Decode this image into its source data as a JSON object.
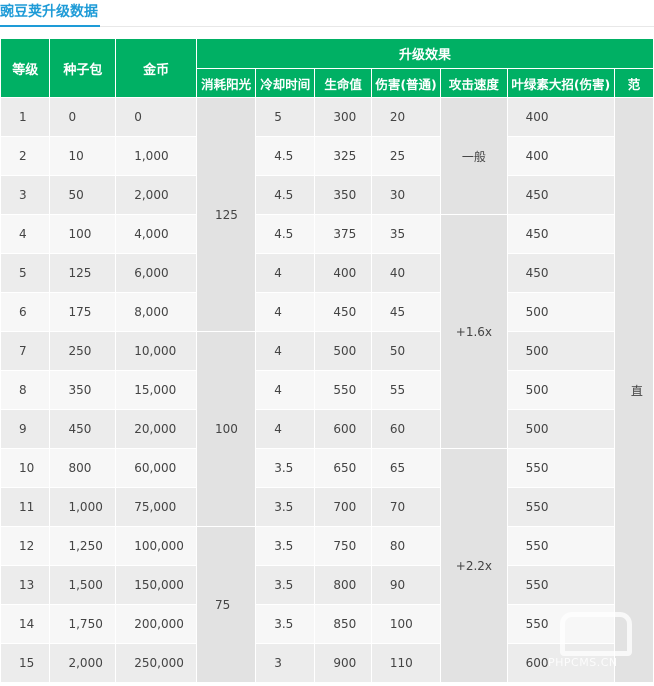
{
  "title": "豌豆荚升级数据",
  "headers": {
    "level": "等级",
    "seeds": "种子包",
    "coins": "金币",
    "effect_group": "升级效果",
    "sun_cost": "消耗阳光",
    "cooldown": "冷却时间",
    "health": "生命值",
    "damage": "伤害(普通)",
    "attack_speed": "攻击速度",
    "chlorophyll": "叶绿素大招(伤害)",
    "range_partial": "范"
  },
  "rows": [
    {
      "level": "1",
      "seeds": "0",
      "coins": "0",
      "cooldown": "5",
      "health": "300",
      "damage": "20",
      "chlorophyll": "400"
    },
    {
      "level": "2",
      "seeds": "10",
      "coins": "1,000",
      "cooldown": "4.5",
      "health": "325",
      "damage": "25",
      "chlorophyll": "400"
    },
    {
      "level": "3",
      "seeds": "50",
      "coins": "2,000",
      "cooldown": "4.5",
      "health": "350",
      "damage": "30",
      "chlorophyll": "450"
    },
    {
      "level": "4",
      "seeds": "100",
      "coins": "4,000",
      "cooldown": "4.5",
      "health": "375",
      "damage": "35",
      "chlorophyll": "450"
    },
    {
      "level": "5",
      "seeds": "125",
      "coins": "6,000",
      "cooldown": "4",
      "health": "400",
      "damage": "40",
      "chlorophyll": "450"
    },
    {
      "level": "6",
      "seeds": "175",
      "coins": "8,000",
      "cooldown": "4",
      "health": "450",
      "damage": "45",
      "chlorophyll": "500"
    },
    {
      "level": "7",
      "seeds": "250",
      "coins": "10,000",
      "cooldown": "4",
      "health": "500",
      "damage": "50",
      "chlorophyll": "500"
    },
    {
      "level": "8",
      "seeds": "350",
      "coins": "15,000",
      "cooldown": "4",
      "health": "550",
      "damage": "55",
      "chlorophyll": "500"
    },
    {
      "level": "9",
      "seeds": "450",
      "coins": "20,000",
      "cooldown": "4",
      "health": "600",
      "damage": "60",
      "chlorophyll": "500"
    },
    {
      "level": "10",
      "seeds": "800",
      "coins": "60,000",
      "cooldown": "3.5",
      "health": "650",
      "damage": "65",
      "chlorophyll": "550"
    },
    {
      "level": "11",
      "seeds": "1,000",
      "coins": "75,000",
      "cooldown": "3.5",
      "health": "700",
      "damage": "70",
      "chlorophyll": "550"
    },
    {
      "level": "12",
      "seeds": "1,250",
      "coins": "100,000",
      "cooldown": "3.5",
      "health": "750",
      "damage": "80",
      "chlorophyll": "550"
    },
    {
      "level": "13",
      "seeds": "1,500",
      "coins": "150,000",
      "cooldown": "3.5",
      "health": "800",
      "damage": "90",
      "chlorophyll": "550"
    },
    {
      "level": "14",
      "seeds": "1,750",
      "coins": "200,000",
      "cooldown": "3.5",
      "health": "850",
      "damage": "100",
      "chlorophyll": "550"
    },
    {
      "level": "15",
      "seeds": "2,000",
      "coins": "250,000",
      "cooldown": "3",
      "health": "900",
      "damage": "110",
      "chlorophyll": "600"
    }
  ],
  "merged": {
    "sun_cost": [
      "125",
      "100",
      "75"
    ],
    "attack_speed": [
      "一般",
      "+1.6x",
      "+2.2x"
    ],
    "range_partial": "直"
  },
  "watermark": {
    "text": "PHPCMS.CN"
  }
}
